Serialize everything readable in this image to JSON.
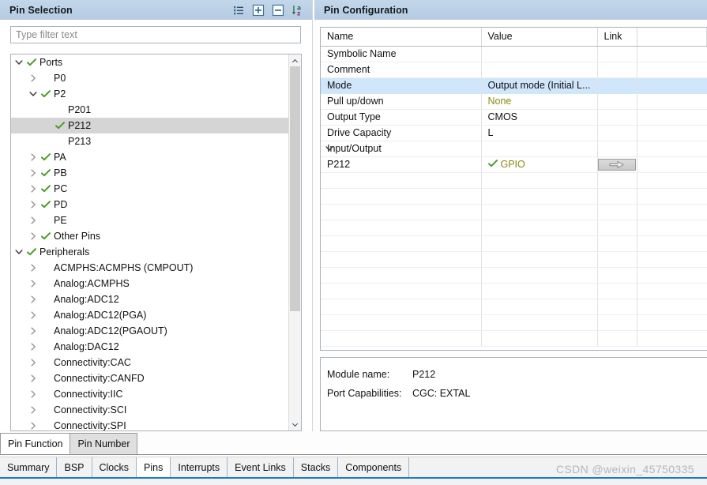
{
  "left_panel": {
    "title": "Pin Selection",
    "toolbar": [
      {
        "name": "list-view-icon",
        "label": "Show List"
      },
      {
        "name": "expand-all-icon",
        "label": "Expand All"
      },
      {
        "name": "collapse-all-icon",
        "label": "Collapse All"
      },
      {
        "name": "sort-az-icon",
        "label": "Sort A-Z"
      }
    ],
    "filter": {
      "value": "",
      "placeholder": "Type filter text"
    },
    "tree": [
      {
        "label": "Ports",
        "depth": 0,
        "twisty": "down",
        "check": true,
        "selected": false
      },
      {
        "label": "P0",
        "depth": 1,
        "twisty": "right",
        "check": false,
        "selected": false
      },
      {
        "label": "P2",
        "depth": 1,
        "twisty": "down",
        "check": true,
        "selected": false
      },
      {
        "label": "P201",
        "depth": 2,
        "twisty": "none",
        "check": false,
        "selected": false
      },
      {
        "label": "P212",
        "depth": 2,
        "twisty": "none",
        "check": true,
        "selected": true
      },
      {
        "label": "P213",
        "depth": 2,
        "twisty": "none",
        "check": false,
        "selected": false
      },
      {
        "label": "PA",
        "depth": 1,
        "twisty": "right",
        "check": true,
        "selected": false
      },
      {
        "label": "PB",
        "depth": 1,
        "twisty": "right",
        "check": true,
        "selected": false
      },
      {
        "label": "PC",
        "depth": 1,
        "twisty": "right",
        "check": true,
        "selected": false
      },
      {
        "label": "PD",
        "depth": 1,
        "twisty": "right",
        "check": true,
        "selected": false
      },
      {
        "label": "PE",
        "depth": 1,
        "twisty": "right",
        "check": false,
        "selected": false
      },
      {
        "label": "Other Pins",
        "depth": 1,
        "twisty": "right",
        "check": true,
        "selected": false
      },
      {
        "label": "Peripherals",
        "depth": 0,
        "twisty": "down",
        "check": true,
        "selected": false
      },
      {
        "label": "ACMPHS:ACMPHS (CMPOUT)",
        "depth": 1,
        "twisty": "right",
        "check": false,
        "selected": false
      },
      {
        "label": "Analog:ACMPHS",
        "depth": 1,
        "twisty": "right",
        "check": false,
        "selected": false
      },
      {
        "label": "Analog:ADC12",
        "depth": 1,
        "twisty": "right",
        "check": false,
        "selected": false
      },
      {
        "label": "Analog:ADC12(PGA)",
        "depth": 1,
        "twisty": "right",
        "check": false,
        "selected": false
      },
      {
        "label": "Analog:ADC12(PGAOUT)",
        "depth": 1,
        "twisty": "right",
        "check": false,
        "selected": false
      },
      {
        "label": "Analog:DAC12",
        "depth": 1,
        "twisty": "right",
        "check": false,
        "selected": false
      },
      {
        "label": "Connectivity:CAC",
        "depth": 1,
        "twisty": "right",
        "check": false,
        "selected": false
      },
      {
        "label": "Connectivity:CANFD",
        "depth": 1,
        "twisty": "right",
        "check": false,
        "selected": false
      },
      {
        "label": "Connectivity:IIC",
        "depth": 1,
        "twisty": "right",
        "check": false,
        "selected": false
      },
      {
        "label": "Connectivity:SCI",
        "depth": 1,
        "twisty": "right",
        "check": false,
        "selected": false
      },
      {
        "label": "Connectivity:SPI",
        "depth": 1,
        "twisty": "right",
        "check": false,
        "selected": false
      }
    ]
  },
  "right_panel": {
    "title": "Pin Configuration",
    "columns": [
      "Name",
      "Value",
      "Link",
      ""
    ],
    "rows": [
      {
        "name": "Symbolic Name",
        "indent": 1,
        "value": "",
        "value_style": "plain",
        "expander": "",
        "highlight": false,
        "link_button": false
      },
      {
        "name": "Comment",
        "indent": 1,
        "value": "",
        "value_style": "plain",
        "expander": "",
        "highlight": false,
        "link_button": false
      },
      {
        "name": "Mode",
        "indent": 1,
        "value": "Output mode (Initial L...",
        "value_style": "plain",
        "expander": "",
        "highlight": true,
        "link_button": false
      },
      {
        "name": "Pull up/down",
        "indent": 1,
        "value": "None",
        "value_style": "olive",
        "expander": "",
        "highlight": false,
        "link_button": false
      },
      {
        "name": "Output Type",
        "indent": 1,
        "value": "CMOS",
        "value_style": "plain",
        "expander": "",
        "highlight": false,
        "link_button": false
      },
      {
        "name": "Drive Capacity",
        "indent": 1,
        "value": "L",
        "value_style": "plain",
        "expander": "",
        "highlight": false,
        "link_button": false
      },
      {
        "name": "Input/Output",
        "indent": 0,
        "value": "",
        "value_style": "plain",
        "expander": "down",
        "highlight": false,
        "link_button": false
      },
      {
        "name": "P212",
        "indent": 2,
        "value": "GPIO",
        "value_style": "check-olive",
        "expander": "",
        "highlight": false,
        "link_button": true
      }
    ],
    "empty_rows": 11,
    "info": {
      "module_label": "Module name:",
      "module_value": "P212",
      "capabilities_label": "Port Capabilities:",
      "capabilities_value": "CGC: EXTAL"
    }
  },
  "sub_tabs": [
    {
      "label": "Pin Function",
      "active": true
    },
    {
      "label": "Pin Number",
      "active": false
    }
  ],
  "main_tabs": [
    {
      "label": "Summary",
      "active": false
    },
    {
      "label": "BSP",
      "active": false
    },
    {
      "label": "Clocks",
      "active": false
    },
    {
      "label": "Pins",
      "active": true
    },
    {
      "label": "Interrupts",
      "active": false
    },
    {
      "label": "Event Links",
      "active": false
    },
    {
      "label": "Stacks",
      "active": false
    },
    {
      "label": "Components",
      "active": false
    }
  ],
  "watermark": "CSDN @weixin_45750335",
  "colors": {
    "panel_header": "#b4cbe2",
    "selection_blue": "#cfe6fb",
    "tree_selection": "#d5d5d5",
    "check_green": "#4e9a28",
    "olive_text": "#8a8a10",
    "tab_accent": "#1d7ac4"
  }
}
